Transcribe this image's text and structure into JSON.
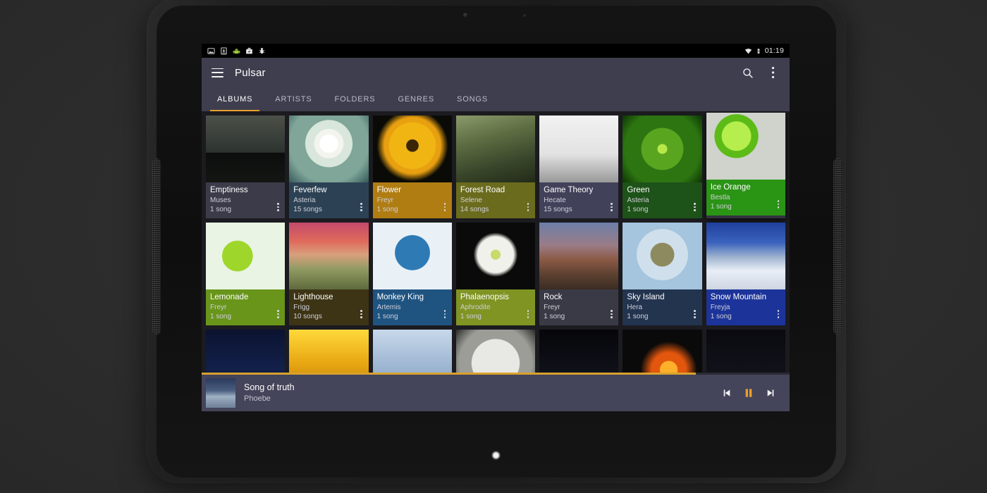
{
  "status_bar": {
    "icons": [
      "image-icon",
      "download-icon",
      "android-icon",
      "briefcase-icon",
      "bug-icon"
    ],
    "right_icons": [
      "wifi-icon",
      "battery-charging-icon"
    ],
    "clock": "01:19"
  },
  "toolbar": {
    "menu_icon": "hamburger-menu-icon",
    "title": "Pulsar",
    "search_icon": "search-icon",
    "overflow_icon": "more-vert-icon"
  },
  "tabs": [
    {
      "label": "ALBUMS",
      "active": true
    },
    {
      "label": "ARTISTS",
      "active": false
    },
    {
      "label": "FOLDERS",
      "active": false
    },
    {
      "label": "GENRES",
      "active": false
    },
    {
      "label": "SONGS",
      "active": false
    }
  ],
  "albums": [
    {
      "title": "Emptiness",
      "artist": "Muses",
      "songs": "1 song",
      "caption_bg": "#3b3b4a",
      "art": "bottles",
      "raised": false
    },
    {
      "title": "Feverfew",
      "artist": "Asteria",
      "songs": "15 songs",
      "caption_bg": "#2c4254",
      "art": "daisy",
      "raised": false
    },
    {
      "title": "Flower",
      "artist": "Freyr",
      "songs": "1 song",
      "caption_bg": "#b07d12",
      "art": "marigold",
      "raised": false
    },
    {
      "title": "Forest Road",
      "artist": "Selene",
      "songs": "14 songs",
      "caption_bg": "#6b6b1e",
      "art": "forest",
      "raised": false
    },
    {
      "title": "Game Theory",
      "artist": "Hecate",
      "songs": "15 songs",
      "caption_bg": "#41415a",
      "art": "chess",
      "raised": false
    },
    {
      "title": "Green",
      "artist": "Asteria",
      "songs": "1 song",
      "caption_bg": "#1d5218",
      "art": "succulent",
      "raised": false
    },
    {
      "title": "Ice Orange",
      "artist": "Bestla",
      "songs": "1 song",
      "caption_bg": "#2a9415",
      "art": "lime",
      "raised": true
    },
    {
      "title": "Lemonade",
      "artist": "Freyr",
      "songs": "1 song",
      "caption_bg": "#68951a",
      "art": "lemonade",
      "raised": false
    },
    {
      "title": "Lighthouse",
      "artist": "Frigg",
      "songs": "10 songs",
      "caption_bg": "#3d3415",
      "art": "lighthouse",
      "raised": false
    },
    {
      "title": "Monkey King",
      "artist": "Artemis",
      "songs": "1 song",
      "caption_bg": "#1f5481",
      "art": "monkey",
      "raised": false
    },
    {
      "title": "Phalaenopsis",
      "artist": "Aphrodite",
      "songs": "1 song",
      "caption_bg": "#7f9423",
      "art": "orchid",
      "raised": false
    },
    {
      "title": "Rock",
      "artist": "Freyr",
      "songs": "1 song",
      "caption_bg": "#3a3a46",
      "art": "rock",
      "raised": false
    },
    {
      "title": "Sky Island",
      "artist": "Hera",
      "songs": "1 song",
      "caption_bg": "#23344f",
      "art": "skyisland",
      "raised": false
    },
    {
      "title": "Snow Mountain",
      "artist": "Freyja",
      "songs": "1 song",
      "caption_bg": "#1c349a",
      "art": "snow",
      "raised": false
    }
  ],
  "albums_row3": [
    {
      "art": "night"
    },
    {
      "art": "goldfeather"
    },
    {
      "art": "cloudsky"
    },
    {
      "art": "moon"
    },
    {
      "art": "darkbird"
    },
    {
      "art": "fire"
    },
    {
      "art": "dark"
    }
  ],
  "now_playing": {
    "title": "Song of truth",
    "artist": "Phoebe",
    "art": "castle",
    "progress_percent": 84,
    "previous_icon": "skip-previous-icon",
    "play_pause_icon": "pause-icon",
    "next_icon": "skip-next-icon",
    "accent_color": "#d9a22e"
  },
  "nav_bar": {
    "back_icon": "back-triangle-icon",
    "home_icon": "home-circle-icon",
    "recents_icon": "recents-square-icon"
  }
}
